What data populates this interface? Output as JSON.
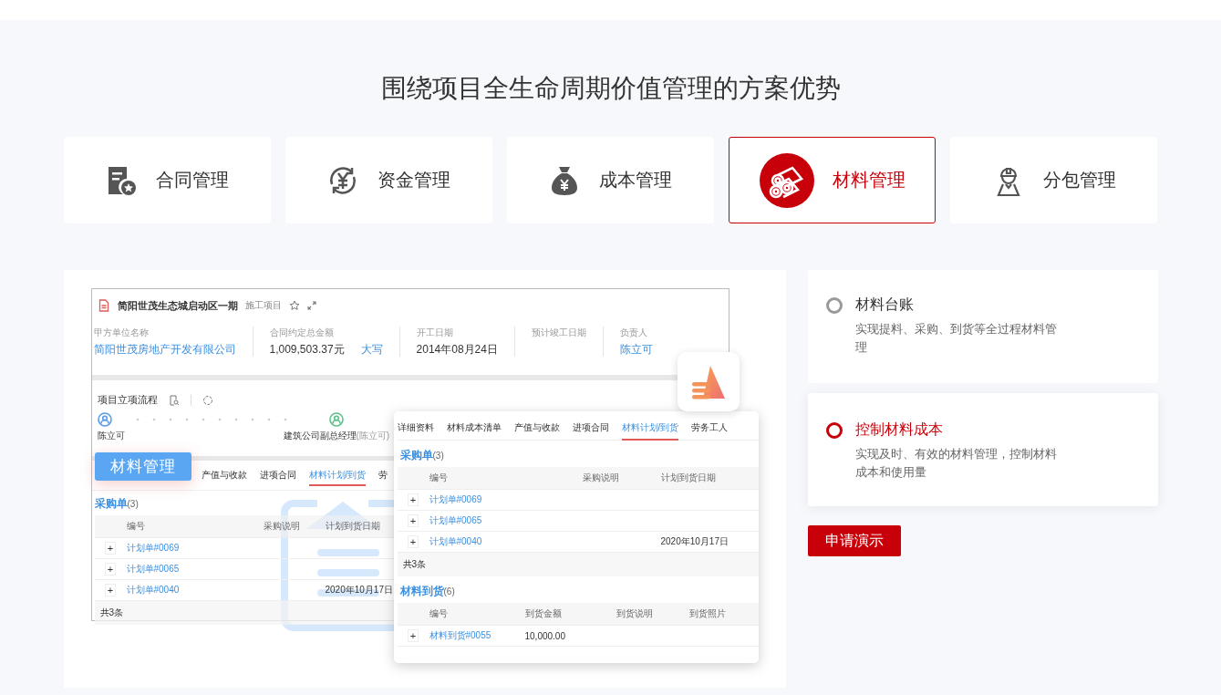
{
  "page": {
    "title": "围绕项目全生命周期价值管理的方案优势"
  },
  "modules": [
    {
      "label": "合同管理",
      "selected": false
    },
    {
      "label": "资金管理",
      "selected": false
    },
    {
      "label": "成本管理",
      "selected": false
    },
    {
      "label": "材料管理",
      "selected": true
    },
    {
      "label": "分包管理",
      "selected": false
    }
  ],
  "preview": {
    "badge": "材料管理",
    "project": {
      "name": "简阳世茂生态城启动区一期",
      "tag": "施工项目",
      "fields": [
        {
          "label": "甲方单位名称",
          "value": "简阳世茂房地产开发有限公司",
          "link": true
        },
        {
          "label": "合同约定总金额",
          "value": "1,009,503.37元",
          "link": false,
          "action": "大写"
        },
        {
          "label": "开工日期",
          "value": "2014年08月24日",
          "link": false
        },
        {
          "label": "预计竣工日期"
        },
        {
          "label": "负责人",
          "value": "陈立可",
          "link": true
        }
      ],
      "flow_title": "项目立项流程",
      "flow_steps": [
        {
          "name": "陈立可",
          "color": "#5b9be6"
        },
        {
          "name": "建筑公司副总经理",
          "note": "(陈立可)",
          "color": "#5cc08c"
        }
      ],
      "tabs": [
        {
          "label": "产值与收款",
          "selected": false
        },
        {
          "label": "进项合同",
          "selected": false
        },
        {
          "label": "材料计划/到货",
          "selected": true
        },
        {
          "label": "劳",
          "selected": false
        }
      ],
      "purchase": {
        "title": "采购单",
        "count": "(3)",
        "columns": [
          "编号",
          "采购说明",
          "计划到货日期"
        ],
        "rows": [
          {
            "expander": "+",
            "code": "计划单#0069"
          },
          {
            "expander": "+",
            "code": "计划单#0065"
          },
          {
            "expander": "+",
            "code": "计划单#0040",
            "date": "2020年10月17日"
          }
        ],
        "footer": "共3条"
      }
    },
    "card": {
      "tabs": [
        {
          "label": "详细资料",
          "selected": false
        },
        {
          "label": "材料成本清单",
          "selected": false
        },
        {
          "label": "产值与收款",
          "selected": false
        },
        {
          "label": "进项合同",
          "selected": false
        },
        {
          "label": "材料计划/到货",
          "selected": true
        },
        {
          "label": "劳务工人",
          "selected": false
        }
      ],
      "purchase": {
        "title": "采购单",
        "count": "(3)",
        "columns": [
          "编号",
          "采购说明",
          "计划到货日期"
        ],
        "rows": [
          {
            "expander": "+",
            "code": "计划单#0069"
          },
          {
            "expander": "+",
            "code": "计划单#0065"
          },
          {
            "expander": "+",
            "code": "计划单#0040",
            "date": "2020年10月17日"
          }
        ],
        "footer": "共3条"
      },
      "arrival": {
        "title": "材料到货",
        "count": "(6)",
        "columns": [
          "编号",
          "到货金额",
          "到货说明",
          "到货照片"
        ],
        "rows": [
          {
            "expander": "+",
            "code": "材料到货#0055",
            "amount": "10,000.00"
          }
        ]
      }
    }
  },
  "features": [
    {
      "title": "材料台账",
      "description": "实现提料、采购、到货等全过程材料管理",
      "selected": false
    },
    {
      "title": "控制材料成本",
      "description": "实现及时、有效的材料管理，控制材料成本和使用量",
      "selected": true
    }
  ],
  "demo_button": "申请演示"
}
